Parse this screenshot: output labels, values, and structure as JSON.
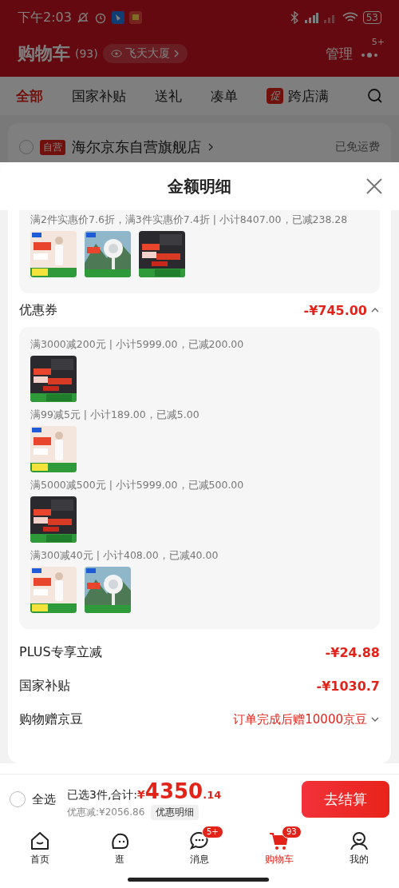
{
  "status_bar": {
    "time": "下午2:03",
    "battery": "53"
  },
  "header": {
    "title": "购物车",
    "count": "(93)",
    "location": "飞天大厦",
    "manage": "管理",
    "more_badge": "5+"
  },
  "tabs": [
    {
      "label": "全部",
      "selected": true
    },
    {
      "label": "国家补贴",
      "selected": false
    },
    {
      "label": "送礼",
      "selected": false
    },
    {
      "label": "凑单",
      "selected": false
    },
    {
      "label": "跨店满",
      "badge": "促",
      "selected": false
    }
  ],
  "store": {
    "checked": false,
    "tag": "自营",
    "name": "海尔京东自营旗舰店",
    "shipping": "已免运费"
  },
  "sheet": {
    "title": "金额明细",
    "top_card": [
      {
        "text": "满2件实惠价7.6折，满3件实惠价7.4折 | 小计8407.00，已减238.28"
      }
    ],
    "rows": [
      {
        "label": "优惠券",
        "value": "-¥745.00",
        "expanded": true,
        "details": [
          {
            "text": "满3000减200元 | 小计5999.00，已减200.00"
          },
          {
            "text": "满99减5元 | 小计189.00，已减5.00"
          },
          {
            "text": "满5000减500元 | 小计5999.00，已减500.00"
          },
          {
            "text": "满300减40元 | 小计408.00，已减40.00"
          }
        ]
      },
      {
        "label": "PLUS专享立减",
        "value": "-¥24.88"
      },
      {
        "label": "国家补贴",
        "value": "-¥1030.7"
      },
      {
        "label": "购物赠京豆",
        "value": "订单完成后赠10000京豆",
        "expanded": false
      }
    ]
  },
  "checkout": {
    "select_all": {
      "label": "全选",
      "checked": false
    },
    "summary": "已选3件,合计:",
    "currency": "¥",
    "total_int": "4350",
    "total_dec": ".14",
    "discount": "优惠减:¥2056.86",
    "detail_button": "优惠明细",
    "submit": "去结算"
  },
  "tabbar": [
    {
      "label": "首页",
      "selected": false
    },
    {
      "label": "逛",
      "selected": false
    },
    {
      "label": "消息",
      "badge": "5+",
      "selected": false
    },
    {
      "label": "购物车",
      "badge": "93",
      "selected": true
    },
    {
      "label": "我的",
      "selected": false
    }
  ]
}
